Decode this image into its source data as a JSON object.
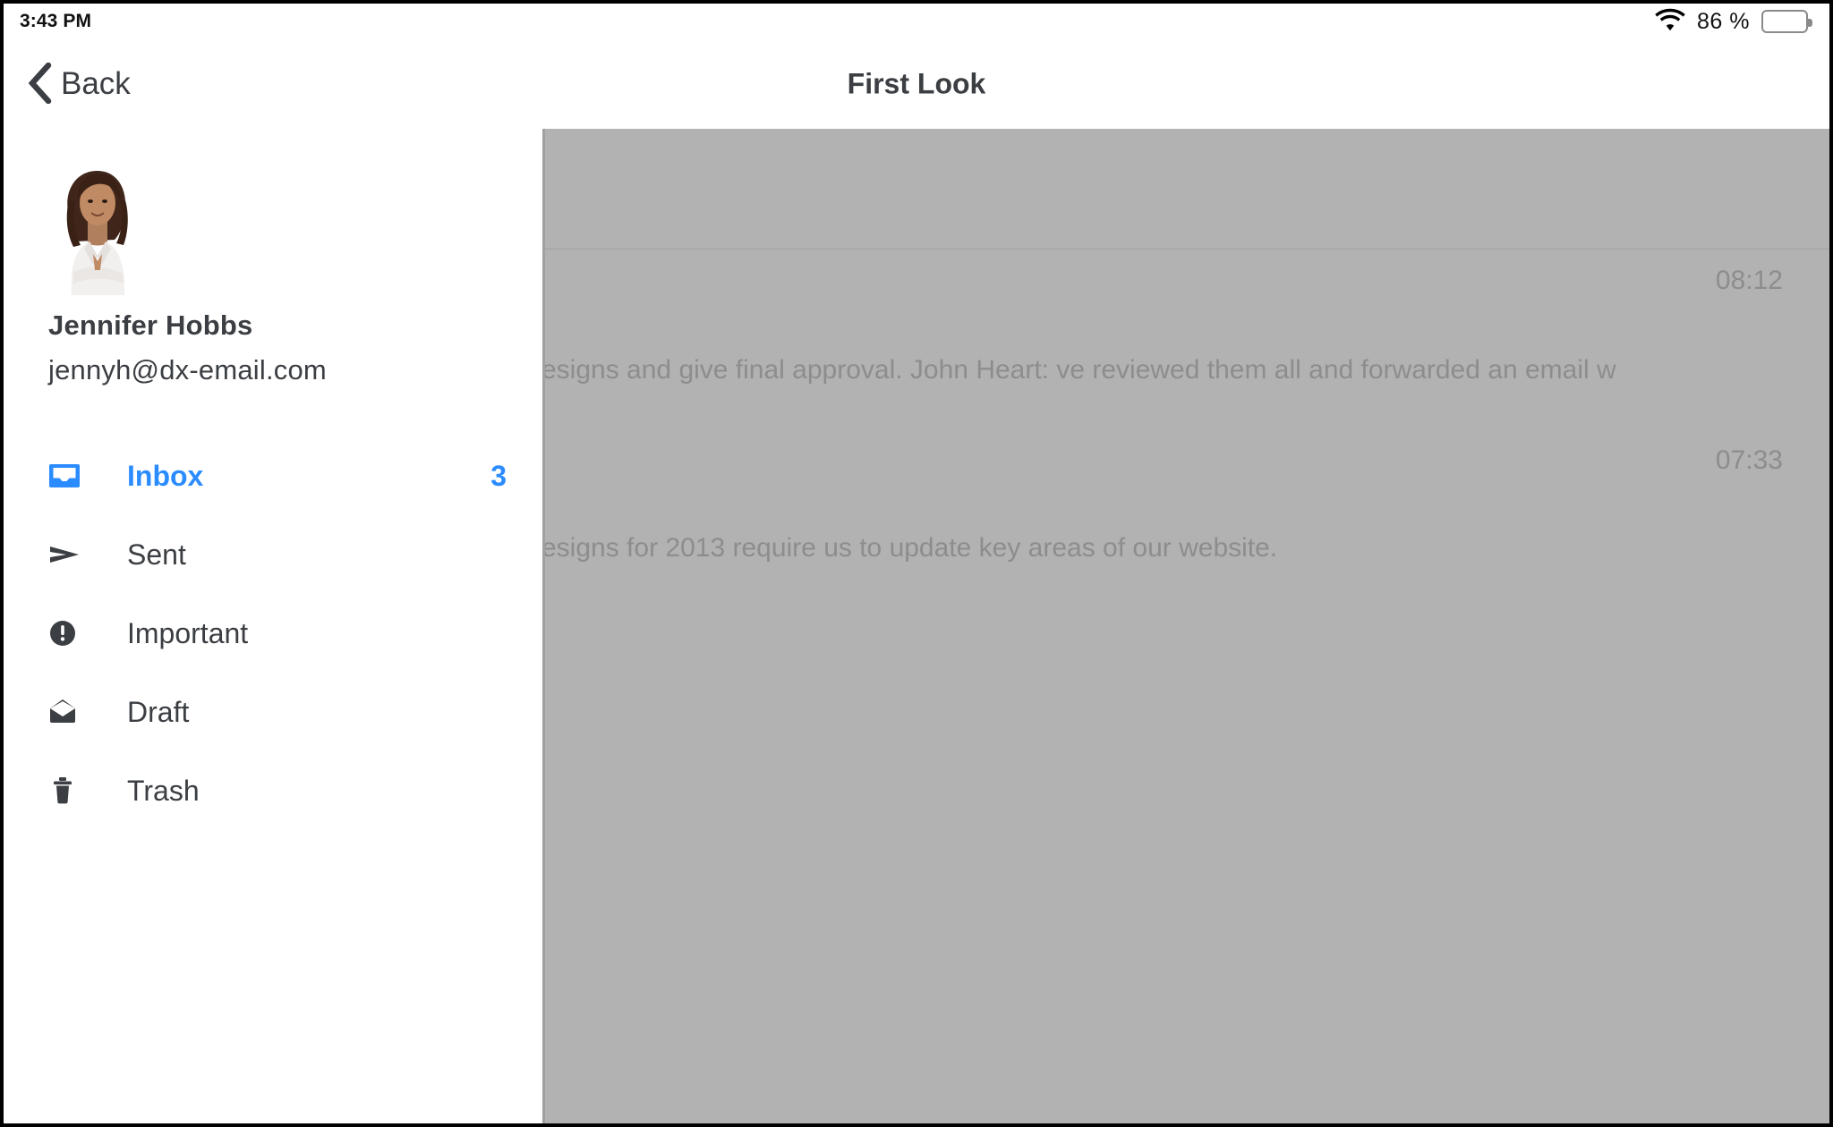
{
  "statusbar": {
    "time": "3:43 PM",
    "wifi_icon": "wifi-icon",
    "battery_percent": "86 %",
    "battery_level": 86,
    "battery_icon": "battery-icon"
  },
  "navbar": {
    "back_label": "Back",
    "back_icon": "chevron-left-icon",
    "title": "First Look"
  },
  "sidebar": {
    "profile": {
      "avatar_alt": "avatar",
      "name": "Jennifer Hobbs",
      "email": "jennyh@dx-email.com"
    },
    "items": [
      {
        "label": "Inbox",
        "icon": "inbox-icon",
        "badge": "3",
        "active": true
      },
      {
        "label": "Sent",
        "icon": "send-icon",
        "badge": "",
        "active": false
      },
      {
        "label": "Important",
        "icon": "exclamation-circle-icon",
        "badge": "",
        "active": false
      },
      {
        "label": "Draft",
        "icon": "envelope-open-icon",
        "badge": "",
        "active": false
      },
      {
        "label": "Trash",
        "icon": "trash-icon",
        "badge": "",
        "active": false
      }
    ]
  },
  "content": {
    "messages": [
      {
        "time": "08:12",
        "snippet": "esigns and give final approval. John Heart: ve reviewed them all and forwarded an email w"
      },
      {
        "time": "07:33",
        "snippet": "esigns for 2013 require us to update key areas of our website."
      }
    ]
  },
  "colors": {
    "accent": "#2b8cff",
    "text": "#3b3e42",
    "overlay": "#b2b2b2",
    "overlay_text": "#8d8d8d",
    "background": "#ffffff"
  }
}
